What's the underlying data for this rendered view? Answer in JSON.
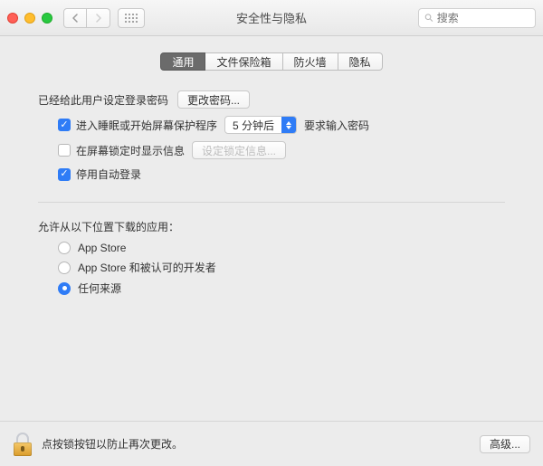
{
  "window": {
    "title": "安全性与隐私"
  },
  "search": {
    "placeholder": "搜索"
  },
  "tabs": [
    "通用",
    "文件保险箱",
    "防火墙",
    "隐私"
  ],
  "activeTab": 0,
  "section1": {
    "loginSetText": "已经给此用户设定登录密码",
    "changePwdBtn": "更改密码...",
    "sleepCheckbox": "进入睡眠或开始屏幕保护程序",
    "sleepSelect": "5 分钟后",
    "sleepSuffix": "要求输入密码",
    "lockMsgCheckbox": "在屏幕锁定时显示信息",
    "lockMsgBtn": "设定锁定信息...",
    "disableAutoLogin": "停用自动登录"
  },
  "section2": {
    "header": "允许从以下位置下载的应用：",
    "options": [
      "App Store",
      "App Store 和被认可的开发者",
      "任何来源"
    ],
    "selected": 2
  },
  "footer": {
    "lockText": "点按锁按钮以防止再次更改。",
    "advancedBtn": "高级..."
  }
}
